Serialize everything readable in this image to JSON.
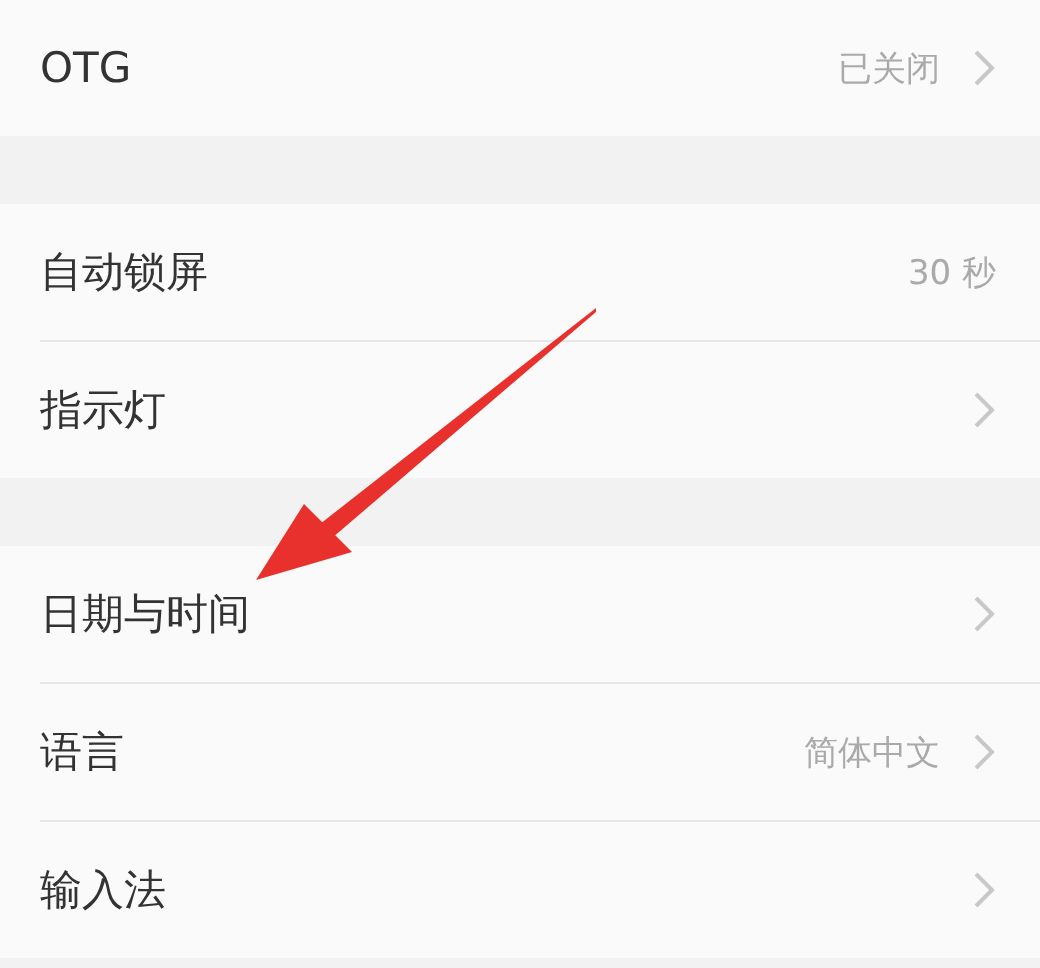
{
  "groups": [
    {
      "rows": [
        {
          "label": "OTG",
          "value": "已关闭",
          "chevron": true
        }
      ]
    },
    {
      "rows": [
        {
          "label": "自动锁屏",
          "value": "30 秒",
          "chevron": false
        },
        {
          "label": "指示灯",
          "chevron": true
        }
      ]
    },
    {
      "rows": [
        {
          "label": "日期与时间",
          "chevron": true
        },
        {
          "label": "语言",
          "value": "简体中文",
          "chevron": true
        },
        {
          "label": "输入法",
          "chevron": true
        }
      ]
    }
  ],
  "annotation": {
    "kind": "arrow"
  }
}
